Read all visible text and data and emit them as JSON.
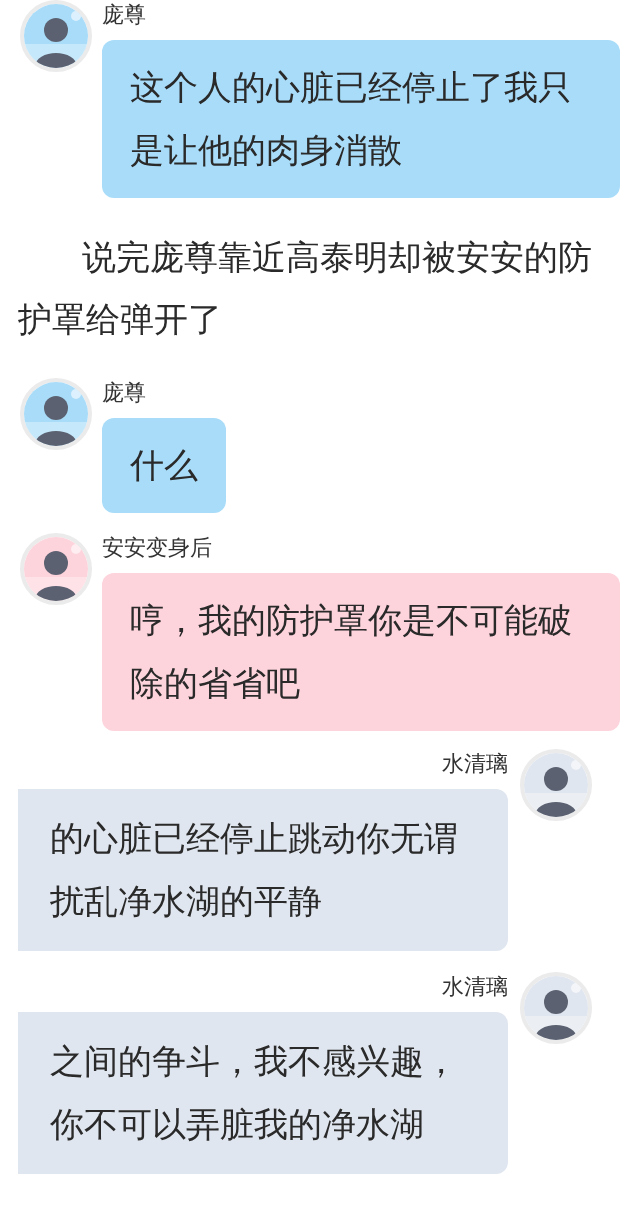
{
  "messages": [
    {
      "kind": "incoming",
      "sender": "庞尊",
      "color": "#a8dcf9",
      "text": "这个人的心脏已经停止了我只是让他的肉身消散"
    },
    {
      "kind": "narration",
      "text": "说完庞尊靠近高泰明却被安安的防护罩给弹开了"
    },
    {
      "kind": "incoming",
      "sender": "庞尊",
      "color": "#a8dcf9",
      "text": "什么"
    },
    {
      "kind": "incoming",
      "sender": "安安变身后",
      "color": "#fdd3dc",
      "text": "哼，我的防护罩你是不可能破除的省省吧"
    },
    {
      "kind": "outgoing",
      "sender": "水清璃",
      "color": "#e0e6ef",
      "lines": [
        "的心脏已经停止跳动你无谓",
        "扰乱净水湖的平静"
      ]
    },
    {
      "kind": "outgoing",
      "sender": "水清璃",
      "color": "#e0e6ef",
      "lines": [
        "之间的争斗，我不感兴趣，",
        "你不可以弄脏我的净水湖"
      ]
    }
  ]
}
